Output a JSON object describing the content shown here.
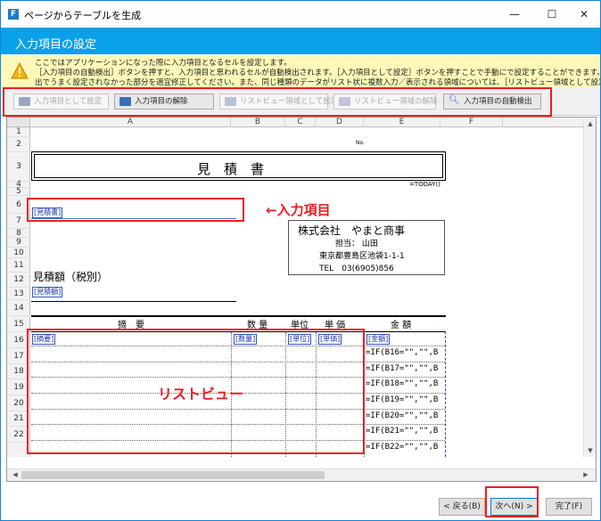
{
  "window": {
    "title": "ページからテーブルを生成",
    "app_icon": "F"
  },
  "header": {
    "title": "入力項目の設定"
  },
  "info": {
    "line1": "ここではアプリケーションになった際に入力項目となるセルを設定します。",
    "line2": "［入力項目の自動検出］ボタンを押すと、入力項目と思われるセルが自動検出されます。［入力項目として設定］ボタンを押すことで手動にで設定することができます。自動検",
    "line3": "出でうまく設定されなかった部分を適宜修正してください。また、同じ種類のデータがリスト状に複数入力／表示される領域については、［リストビュー領域として設定］を押してリ…"
  },
  "toolbar": {
    "set_input": "入力項目として設定",
    "remove_input": "入力項目の解除",
    "set_listview": "リストビュー領域として設定",
    "remove_listview": "リストビュー領域の解除",
    "auto_detect": "入力項目の自動検出"
  },
  "sheet": {
    "columns": [
      "A",
      "B",
      "C",
      "D",
      "E",
      "F"
    ],
    "rows": [
      "1",
      "2",
      "3",
      "4",
      "5",
      "6",
      "7",
      "8",
      "9",
      "10",
      "11",
      "12",
      "13",
      "14",
      "15",
      "16",
      "17",
      "18",
      "19",
      "20",
      "21",
      "22"
    ],
    "no_label": "No.",
    "title": "見　積　書",
    "today": "=TODAY()",
    "company": "株式会社　やまと商事",
    "person": "担当：  山田",
    "address": "東京都豊島区池袋1-1-1",
    "tel": "TEL　03(6905)856",
    "amount_label": "見積額（税別）",
    "headers": {
      "summary": "摘　要",
      "qty": "数 量",
      "unit": "単位",
      "price": "単 価",
      "amount": "金 額"
    },
    "tags": {
      "mitsumorisho": "[見積書]",
      "mitsumorigaku": "[見積額]",
      "summary": "[摘要]",
      "qty": "[数量]",
      "unit": "[単位]",
      "price": "[単価]",
      "amount": "[金額]"
    },
    "formulas": [
      "=IF(B16=\"\",\"\",B",
      "=IF(B17=\"\",\"\",B",
      "=IF(B18=\"\",\"\",B",
      "=IF(B19=\"\",\"\",B",
      "=IF(B20=\"\",\"\",B",
      "=IF(B21=\"\",\"\",B",
      "=IF(B22=\"\",\"\",B"
    ]
  },
  "annotations": {
    "input_item": "←入力項目",
    "listview": "リストビュー"
  },
  "nav": {
    "back": "< 戻る(B)",
    "next": "次へ(N) >",
    "finish": "完了(F)"
  }
}
